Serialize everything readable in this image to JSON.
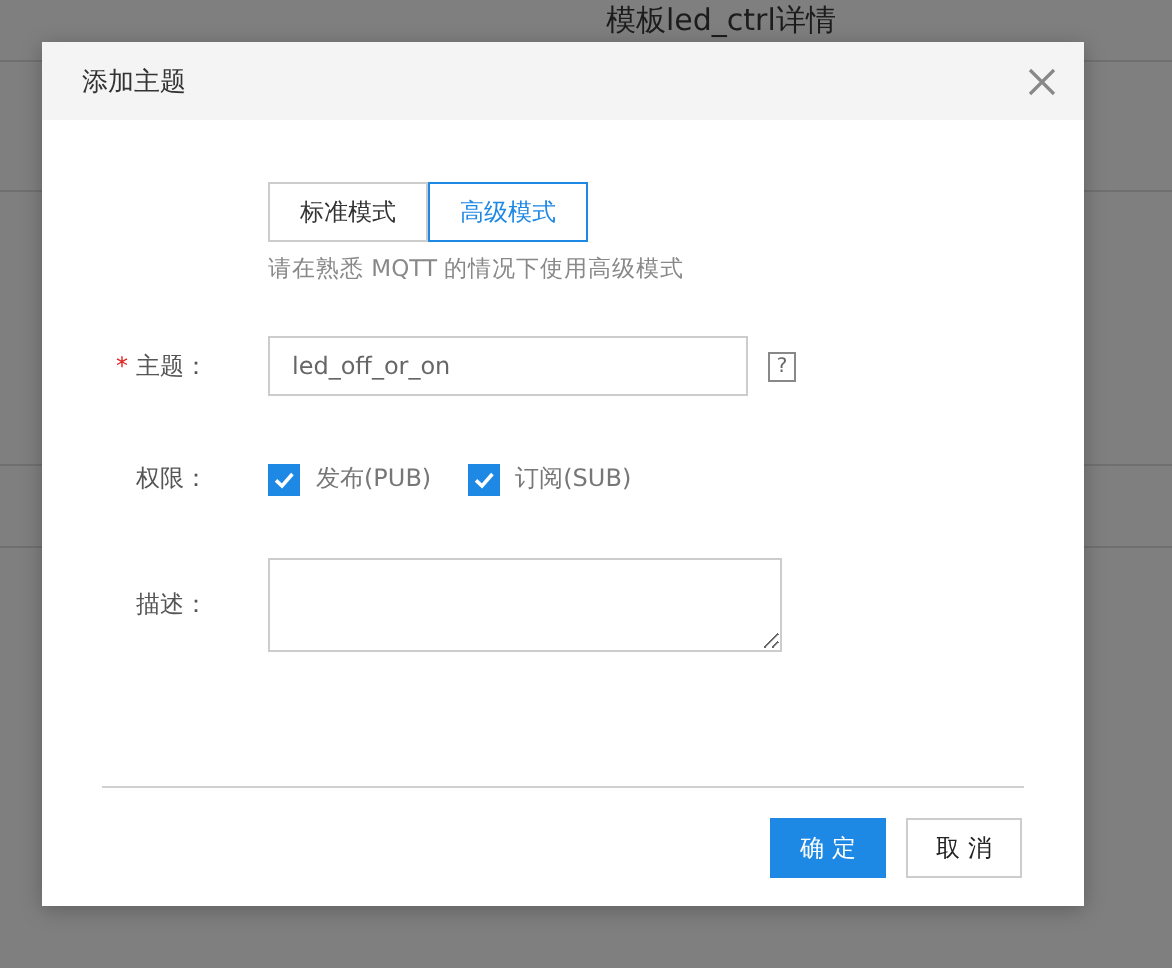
{
  "background_page": {
    "title": "模板led_ctrl详情"
  },
  "dialog": {
    "title": "添加主题",
    "modes": [
      {
        "label": "标准模式",
        "selected": false
      },
      {
        "label": "高级模式",
        "selected": true
      }
    ],
    "mode_hint": "请在熟悉 MQTT 的情况下使用高级模式",
    "fields": [
      {
        "kind": "text",
        "required_mark": "*",
        "label": "主题：",
        "value": "led_off_or_on",
        "help": "?"
      },
      {
        "kind": "checkboxes",
        "label": "权限：",
        "options": [
          {
            "label": "发布(PUB)",
            "checked": true
          },
          {
            "label": "订阅(SUB)",
            "checked": true
          }
        ]
      },
      {
        "kind": "textarea",
        "label": "描述："
      }
    ],
    "buttons": [
      {
        "label": "确 定",
        "kind": "primary"
      },
      {
        "label": "取 消",
        "kind": "default"
      }
    ]
  }
}
